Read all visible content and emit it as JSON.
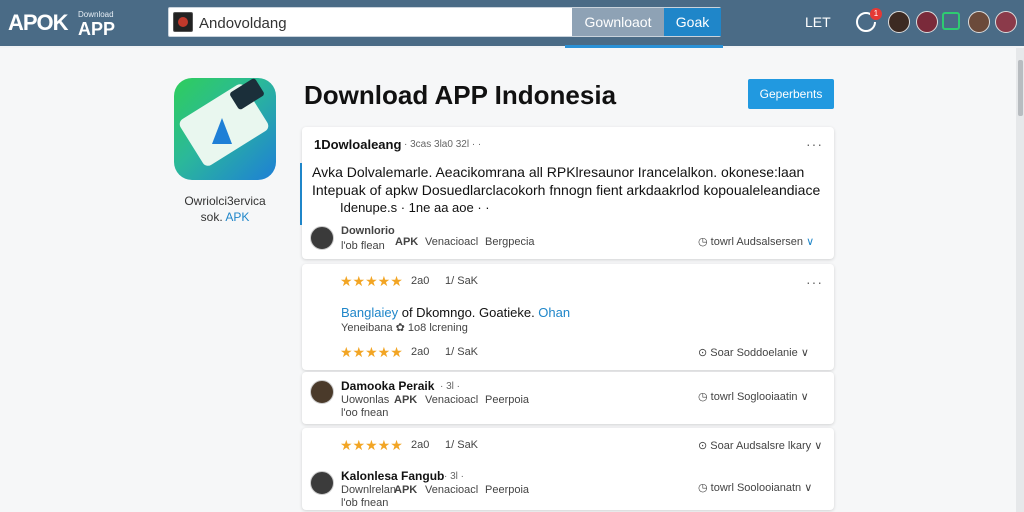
{
  "header": {
    "logo_main": "APOK",
    "logo_sub_top": "Download",
    "logo_sub": "APP",
    "search_value": "Andovoldang",
    "download_button": "Gownloaot",
    "go_button": "Goak",
    "menu_label": "LET",
    "notif_count": "1"
  },
  "app": {
    "caption_line1": "Owriolci3ervica",
    "caption_line2_prefix": "sok.",
    "caption_line2_hl": "APK",
    "page_title": "Download APP Indonesia",
    "get_button": "Geperbents"
  },
  "cards": [
    {
      "head": "1Dowloaleang",
      "meta": "· 3cas 3la0 32l · ·",
      "body_line1": "Avka Dolvalemarle. Aeacikomrana all RPKlresaunor Irancelalkon. okonese:laan",
      "body_line2": "Intepuak of apkw Dosuedlarclacokorh fnnogn fient arkdaakrlod kopoualeleandiace",
      "body_line3": "Idenupe.s · 1ne aa aoe · ·",
      "user_name": "Downlorio",
      "user_sub": "l'ob flean",
      "user_apk": "APK",
      "user_loc": "Venacioacl",
      "user_tag": "Bergpecia",
      "right_text": "towrl Audsalsersen"
    },
    {
      "rating_count": "2a0",
      "rating_meta": "1/ SaK",
      "title_a": "Banglaiey",
      "title_b": " of Dkomngo. Goatieke.",
      "title_c": " Ohan",
      "sub": "Yeneibana ✿ 1o8 lcrening",
      "rating_count2": "2a0",
      "rating_meta2": "1/ SaK",
      "right_text": "Soar Soddoelanie"
    },
    {
      "user_name": "Damooka Peraik",
      "user_meta": "· 3l ·",
      "user_sub": "Uowonlas",
      "user_apk": "APK",
      "user_loc": "Venacioacl",
      "user_tag": "Peerpoia",
      "user_sub2": "l'oo fnean",
      "right_text": "towrl Soglooiaatin"
    },
    {
      "rating_count": "2a0",
      "rating_meta": "1/ SaK",
      "right_top": "Soar Audsalsre lkary",
      "user_name": "Kalonlesa Fangub",
      "user_meta": "· 3l ·",
      "user_sub": "Downlrelan",
      "user_apk": "APK",
      "user_loc": "Venacioacl",
      "user_tag": "Peerpoia",
      "user_sub2": "l'ob fnean",
      "right_text": "towrl Soolooianatn"
    }
  ],
  "colors": {
    "header_bg": "#4a6b86",
    "accent_blue": "#1f86c9",
    "accent_green": "#1aa35a",
    "star": "#f2a524"
  }
}
